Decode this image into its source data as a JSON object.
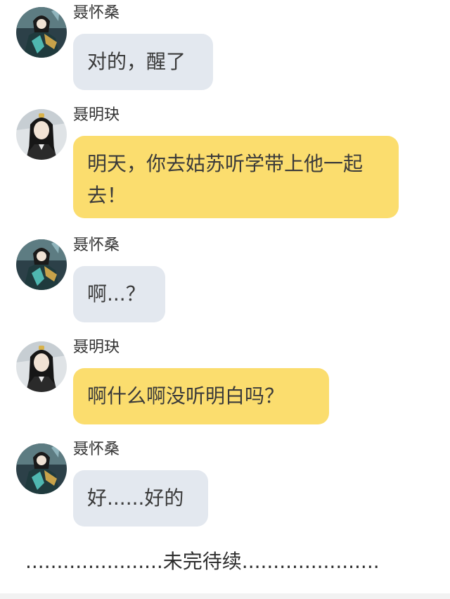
{
  "messages": [
    {
      "sender": "聂怀桑",
      "avatar_icon": "nie-huaisang-avatar-icon",
      "text": "对的，醒了",
      "bubble_color": "#e3e8ef"
    },
    {
      "sender": "聂明玦",
      "avatar_icon": "nie-mingjue-avatar-icon",
      "text": "明天，你去姑苏听学带上他一起去！",
      "bubble_color": "#fbdd6e"
    },
    {
      "sender": "聂怀桑",
      "avatar_icon": "nie-huaisang-avatar-icon",
      "text": "啊...？",
      "bubble_color": "#e3e8ef"
    },
    {
      "sender": "聂明玦",
      "avatar_icon": "nie-mingjue-avatar-icon",
      "text": "啊什么啊没听明白吗？",
      "bubble_color": "#fbdd6e"
    },
    {
      "sender": "聂怀桑",
      "avatar_icon": "nie-huaisang-avatar-icon",
      "text": "好......好的",
      "bubble_color": "#e3e8ef"
    }
  ],
  "ending_text": "......................未完待续......................"
}
